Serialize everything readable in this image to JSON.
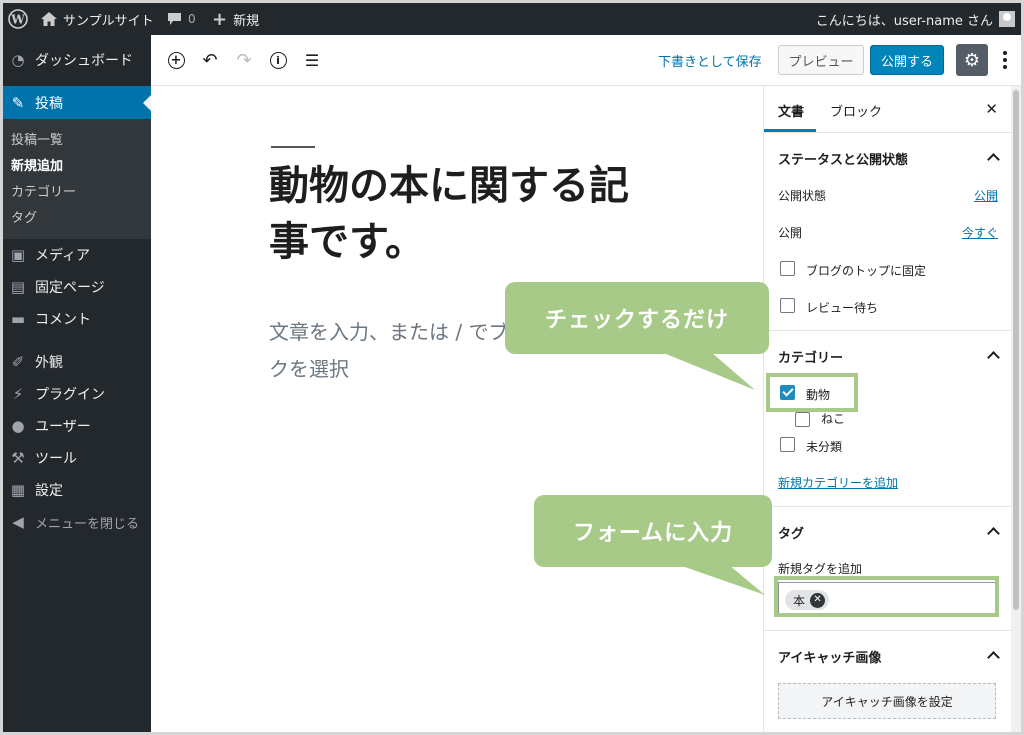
{
  "admin_bar": {
    "site_name": "サンプルサイト",
    "comment_count": "0",
    "new_label": "新規",
    "greeting": "こんにちは、user-name さん"
  },
  "sidebar": {
    "items": [
      {
        "label": "ダッシュボード",
        "icon": "gauge-icon"
      },
      {
        "label": "投稿",
        "icon": "pin-icon"
      },
      {
        "label": "メディア",
        "icon": "media-icon"
      },
      {
        "label": "固定ページ",
        "icon": "page-icon"
      },
      {
        "label": "コメント",
        "icon": "comment-icon"
      },
      {
        "label": "外観",
        "icon": "brush-icon"
      },
      {
        "label": "プラグイン",
        "icon": "plugin-icon"
      },
      {
        "label": "ユーザー",
        "icon": "user-icon"
      },
      {
        "label": "ツール",
        "icon": "wrench-icon"
      },
      {
        "label": "設定",
        "icon": "settings-icon"
      }
    ],
    "submenu": [
      "投稿一覧",
      "新規追加",
      "カテゴリー",
      "タグ"
    ],
    "collapse_label": "メニューを閉じる"
  },
  "toolbar": {
    "save_draft": "下書きとして保存",
    "preview": "プレビュー",
    "publish": "公開する"
  },
  "editor": {
    "title": "動物の本に関する記事です。",
    "placeholder": "文章を入力、または / でブロックを選択"
  },
  "panel": {
    "tabs": [
      "文書",
      "ブロック"
    ],
    "status": {
      "title": "ステータスと公開状態",
      "visibility_label": "公開状態",
      "visibility_value": "公開",
      "publish_label": "公開",
      "publish_value": "今すぐ",
      "sticky_label": "ブログのトップに固定",
      "pending_label": "レビュー待ち"
    },
    "categories": {
      "title": "カテゴリー",
      "items": [
        {
          "label": "動物",
          "checked": true
        },
        {
          "label": "ねこ",
          "checked": false
        },
        {
          "label": "未分類",
          "checked": false
        }
      ],
      "add_link": "新規カテゴリーを追加"
    },
    "tags": {
      "title": "タグ",
      "add_label": "新規タグを追加",
      "tag": "本"
    },
    "featured": {
      "title": "アイキャッチ画像",
      "button": "アイキャッチ画像を設定"
    }
  },
  "callouts": {
    "check": "チェックするだけ",
    "form": "フォームに入力"
  },
  "colors": {
    "accent": "#0085ba",
    "callout": "#a7ca89",
    "admin_dark": "#23282d"
  }
}
